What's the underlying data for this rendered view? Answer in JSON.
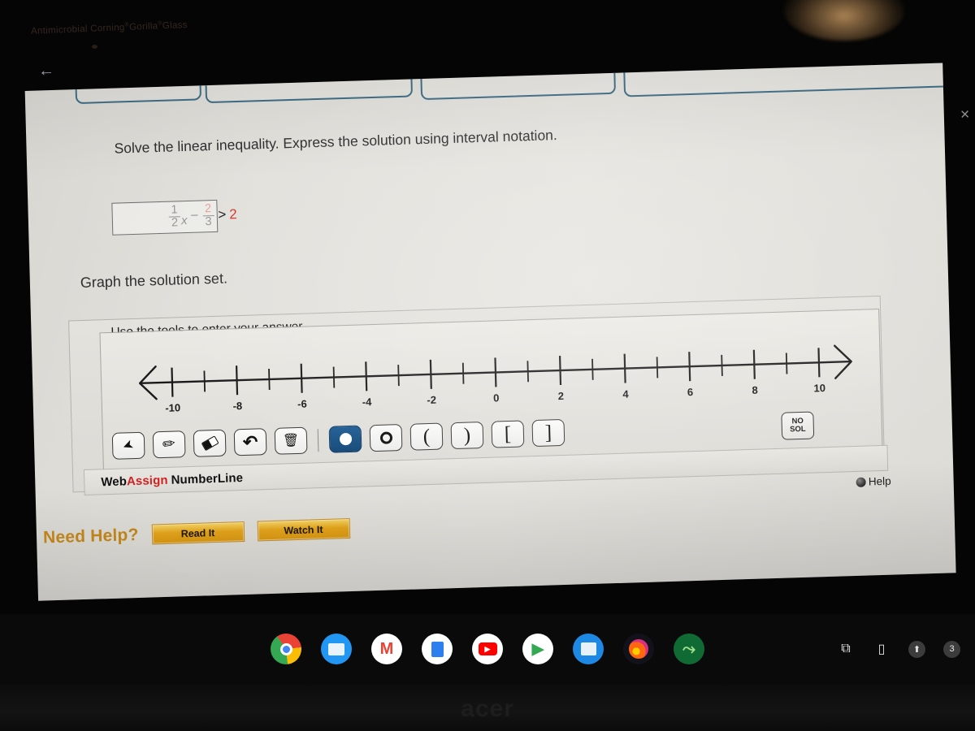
{
  "device": {
    "bezel_text_prefix": "Antimicrobial Corning",
    "bezel_text_mid": "Gorilla",
    "bezel_text_suffix": "Glass",
    "brand": "acer",
    "back_arrow": "←"
  },
  "window_controls": {
    "minimize": "—",
    "restore": "❐",
    "close": "✕"
  },
  "question": {
    "prompt": "Solve the linear inequality. Express the solution using interval notation.",
    "expression": {
      "frac1_num": "1",
      "frac1_den": "2",
      "variable": "x",
      "minus": "−",
      "frac2_num": "2",
      "frac2_den": "3",
      "relation": ">",
      "right_side": "2",
      "red_color": "#d9352c"
    },
    "answer_value": "",
    "answer_placeholder": "",
    "graph_prompt": "Graph the solution set."
  },
  "numberline_widget": {
    "instruction": "Use the tools to enter your answer.",
    "logo_web": "Web",
    "logo_assign": "Assign",
    "logo_product": "NumberLine",
    "help_label": "Help",
    "no_solution_line1": "NO",
    "no_solution_line2": "SOL",
    "tools": [
      {
        "name": "select-tool",
        "glyph": "➤",
        "selected": false
      },
      {
        "name": "pencil-tool",
        "glyph": "✎",
        "selected": false
      },
      {
        "name": "eraser-tool",
        "glyph": "◆",
        "selected": false
      },
      {
        "name": "undo-tool",
        "glyph": "↶",
        "selected": false
      },
      {
        "name": "delete-tool",
        "glyph": "🗑",
        "selected": false
      },
      {
        "name": "closed-point-tool",
        "glyph": "●",
        "selected": true
      },
      {
        "name": "open-point-tool",
        "glyph": "○",
        "selected": false
      },
      {
        "name": "open-paren-left",
        "glyph": "(",
        "selected": false
      },
      {
        "name": "open-paren-right",
        "glyph": ")",
        "selected": false
      },
      {
        "name": "bracket-left",
        "glyph": "[",
        "selected": false
      },
      {
        "name": "bracket-right",
        "glyph": "]",
        "selected": false
      }
    ]
  },
  "chart_data": {
    "type": "numberline",
    "title": "Graph the solution set.",
    "xlim": [
      -11,
      11
    ],
    "major_ticks": [
      -10,
      -8,
      -6,
      -4,
      -2,
      0,
      2,
      4,
      6,
      8,
      10
    ],
    "minor_ticks": [
      -9,
      -7,
      -5,
      -3,
      -1,
      1,
      3,
      5,
      7,
      9
    ],
    "tick_labels": [
      "-10",
      "-8",
      "-6",
      "-4",
      "-2",
      "0",
      "2",
      "4",
      "6",
      "8",
      "10"
    ],
    "arrows": [
      "left",
      "right"
    ],
    "plotted_points": [],
    "plotted_intervals": [],
    "grid": false,
    "xlabel": "",
    "ylabel": ""
  },
  "need_help": {
    "label": "Need Help?",
    "read_it": "Read It",
    "watch_it": "Watch It"
  },
  "shelf": {
    "apps": [
      {
        "name": "chrome",
        "label": "",
        "running": true
      },
      {
        "name": "files",
        "label": "",
        "running": false
      },
      {
        "name": "gmail",
        "label": "M",
        "running": true
      },
      {
        "name": "docs",
        "label": "",
        "running": false
      },
      {
        "name": "youtube",
        "label": "",
        "running": false
      },
      {
        "name": "play-store",
        "label": "",
        "running": false
      },
      {
        "name": "keep",
        "label": "",
        "running": false
      },
      {
        "name": "firefox",
        "label": "",
        "running": true
      },
      {
        "name": "desmos",
        "label": "",
        "running": true
      }
    ],
    "tray": {
      "screen-capture": "⧉",
      "phone-hub": "▯",
      "upload": "⬆",
      "notification_count": "3"
    }
  }
}
